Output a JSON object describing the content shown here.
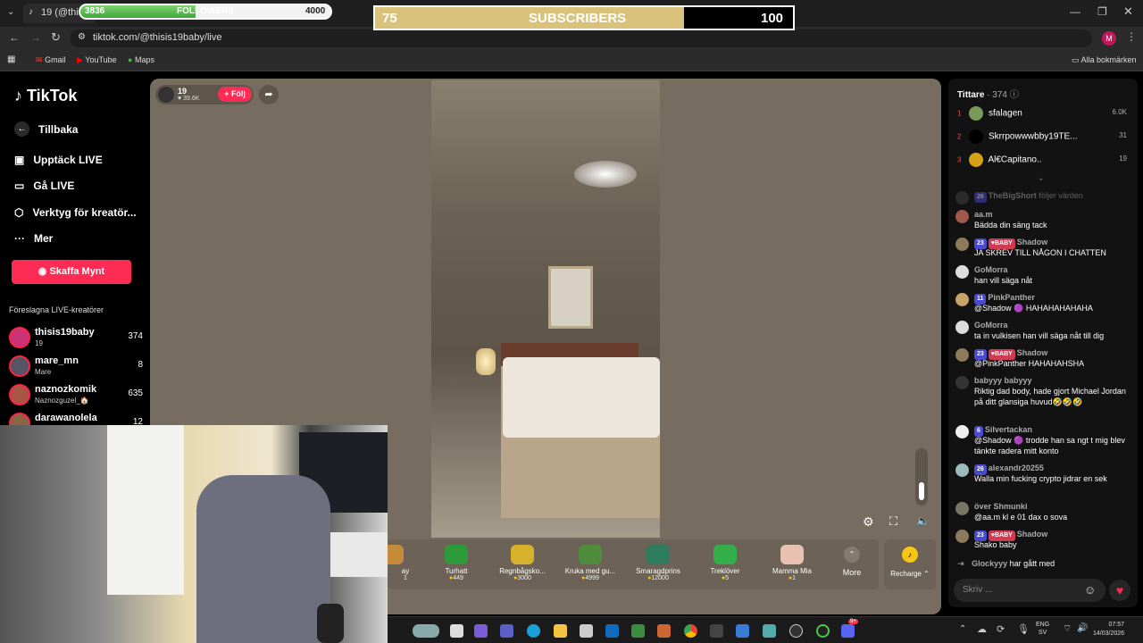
{
  "browser": {
    "tab_title": "19 (@thisis",
    "url": "tiktok.com/@thisis19baby/live",
    "bookmarks": [
      "Gmail",
      "YouTube",
      "Maps"
    ],
    "all_bookmarks": "Alla bokmärken",
    "profile_initial": "M"
  },
  "overlay": {
    "followers": {
      "current": "3836",
      "label": "FOLLOWERS",
      "goal": "4000",
      "progress": 0.46
    },
    "subscribers": {
      "current": "75",
      "label": "SUBSCRIBERS",
      "goal": "100",
      "progress": 0.74
    }
  },
  "sidebar": {
    "logo": "TikTok",
    "back": "Tillbaka",
    "nav": [
      "Upptäck LIVE",
      "Gå LIVE",
      "Verktyg för kreatör...",
      "Mer"
    ],
    "coins_button": "Skaffa Mynt",
    "suggested_heading": "Föreslagna LIVE-kreatörer",
    "creators": [
      {
        "name": "thisis19baby",
        "sub": "19",
        "count": "374"
      },
      {
        "name": "mare_mn",
        "sub": "Mare",
        "count": "8"
      },
      {
        "name": "naznozkomik",
        "sub": "Naznozguzel_🏠",
        "count": "635"
      },
      {
        "name": "darawanolela",
        "sub": "",
        "count": "12"
      }
    ]
  },
  "stream": {
    "host_name": "19",
    "host_likes": "39.6K",
    "follow_button": "+ Följ"
  },
  "gifts": [
    {
      "name": "ay",
      "price": "1",
      "color": "#c58a3a"
    },
    {
      "name": "Turhatt",
      "price": "449",
      "color": "#2e9b3a"
    },
    {
      "name": "Regnbågsko...",
      "price": "3000",
      "color": "#d6b22c"
    },
    {
      "name": "Kruka med gu...",
      "price": "4999",
      "color": "#4f8c3c"
    },
    {
      "name": "Smaragdprins",
      "price": "12000",
      "color": "#2f7d5e"
    },
    {
      "name": "Treklöver",
      "price": "5",
      "color": "#34b04a"
    },
    {
      "name": "Mamma Mia",
      "price": "1",
      "color": "#e8c2b0"
    }
  ],
  "gift_more": "More",
  "recharge": "Recharge",
  "viewers": {
    "heading": "Tittare",
    "count": "374",
    "top": [
      {
        "rank": "1",
        "name": "sfalagen",
        "value": "6.0K"
      },
      {
        "rank": "2",
        "name": "Skrrpowwwbby19TE...",
        "value": "31"
      },
      {
        "rank": "3",
        "name": "Al€Capitano..",
        "value": "19"
      }
    ]
  },
  "chat": [
    {
      "name": "TheBigShort",
      "badge": "26",
      "baby": false,
      "text": "följer värden",
      "inline": true
    },
    {
      "name": "aa.m",
      "badge": "",
      "baby": false,
      "text": "Bädda din säng tack"
    },
    {
      "name": "Shadow",
      "badge": "23",
      "baby": true,
      "text": "JA SKREV TILL NÅGON I CHATTEN"
    },
    {
      "name": "GoMorra",
      "badge": "",
      "baby": false,
      "text": "han vill säga nåt"
    },
    {
      "name": "PinkPanther",
      "badge": "11",
      "baby": false,
      "text": "@Shadow 🟣 HAHAHAHAHAHA"
    },
    {
      "name": "GoMorra",
      "badge": "",
      "baby": false,
      "text": "ta in vulkisen han vill säga nåt till dig"
    },
    {
      "name": "Shadow",
      "badge": "23",
      "baby": true,
      "text": "@PinkPanther HAHAHAHSHA"
    },
    {
      "name": "babyyy babyyy",
      "badge": "",
      "baby": false,
      "text": "Riktig dad body, hade gjort Michael Jordan på ditt glansiga huvud🤣🤣🤣"
    },
    {
      "name": "Silvertackan",
      "badge": "6",
      "baby": false,
      "text": "@Shadow 🟣 trodde han sa ngt t mig blev tänkte radera mitt konto"
    },
    {
      "name": "alexandr20255",
      "badge": "26",
      "baby": false,
      "text": "Walla min fucking crypto jidrar en sek"
    },
    {
      "name": "över Shmunki",
      "badge": "",
      "baby": false,
      "text": "@aa.m kl e 01 dax o sova"
    },
    {
      "name": "Shadow",
      "badge": "23",
      "baby": true,
      "text": "Shako baby"
    }
  ],
  "joined": {
    "name": "Glockyyy",
    "text": "har gått med"
  },
  "chat_placeholder": "Skriv ...",
  "taskbar": {
    "lang": "ENG",
    "region": "SV",
    "time": "07:57",
    "date": "14/03/2026",
    "notify": "9+"
  }
}
